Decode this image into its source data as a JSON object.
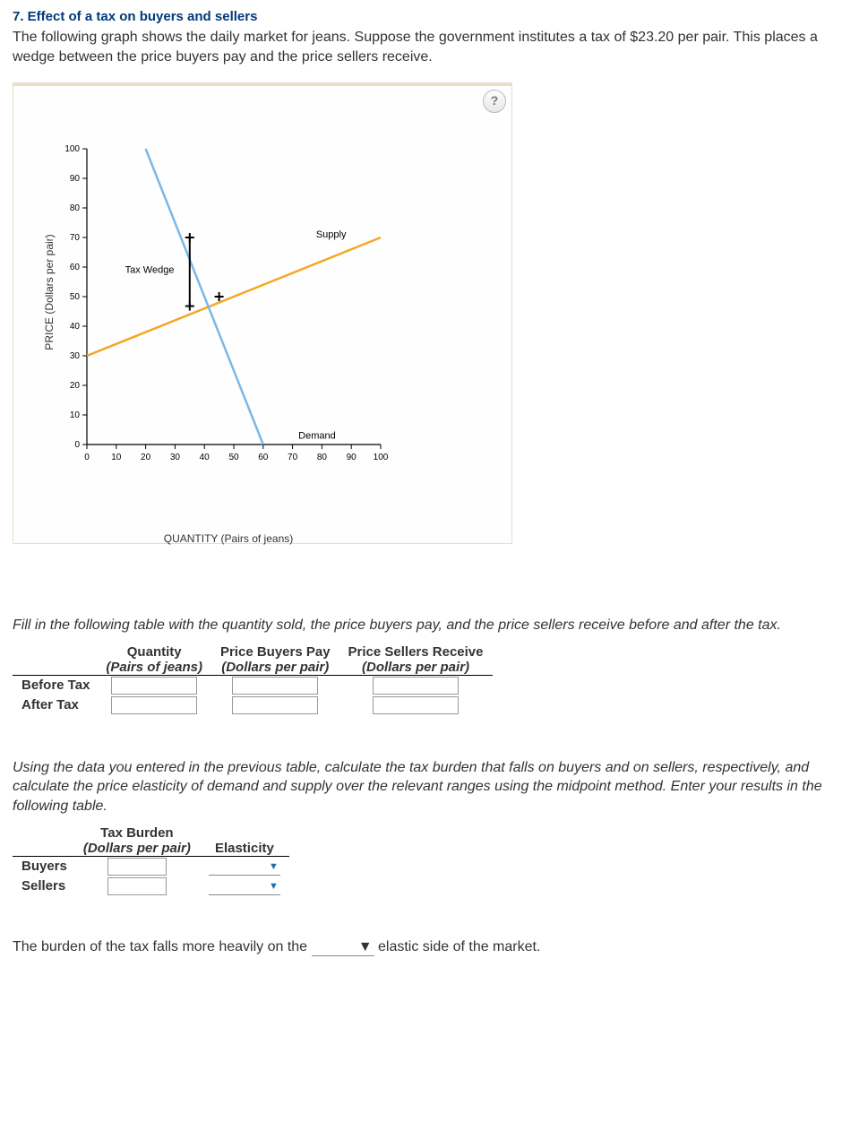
{
  "title": "7. Effect of a tax on buyers and sellers",
  "intro": "The following graph shows the daily market for jeans. Suppose the government institutes a tax of $23.20 per pair. This places a wedge between the price buyers pay and the price sellers receive.",
  "help_label": "?",
  "chart_data": {
    "type": "line",
    "xlabel": "QUANTITY (Pairs of jeans)",
    "ylabel": "PRICE (Dollars per pair)",
    "xlim": [
      0,
      100
    ],
    "ylim": [
      0,
      100
    ],
    "xticks": [
      0,
      10,
      20,
      30,
      40,
      50,
      60,
      70,
      80,
      90,
      100
    ],
    "yticks": [
      0,
      10,
      20,
      30,
      40,
      50,
      60,
      70,
      80,
      90,
      100
    ],
    "series": [
      {
        "name": "Supply",
        "color": "#f5a623",
        "x": [
          0,
          100
        ],
        "y": [
          30,
          70
        ]
      },
      {
        "name": "Demand",
        "color": "#7ab8e6",
        "x": [
          20,
          60
        ],
        "y": [
          100,
          0
        ]
      }
    ],
    "tax_wedge_label": "Tax Wedge",
    "wedge": {
      "x": 35,
      "y_top": 70,
      "y_bottom": 46.8
    },
    "equilibrium_marker": {
      "x": 45,
      "y": 50
    }
  },
  "table1": {
    "instr": "Fill in the following table with the quantity sold, the price buyers pay, and the price sellers receive before and after the tax.",
    "cols": [
      {
        "top": "Quantity",
        "sub": "(Pairs of jeans)"
      },
      {
        "top": "Price Buyers Pay",
        "sub": "(Dollars per pair)"
      },
      {
        "top": "Price Sellers Receive",
        "sub": "(Dollars per pair)"
      }
    ],
    "rows": [
      "Before Tax",
      "After Tax"
    ]
  },
  "table2": {
    "instr": "Using the data you entered in the previous table, calculate the tax burden that falls on buyers and on sellers, respectively, and calculate the price elasticity of demand and supply over the relevant ranges using the midpoint method. Enter your results in the following table.",
    "cols": [
      {
        "top": "Tax Burden",
        "sub": "(Dollars per pair)"
      },
      {
        "top": "Elasticity",
        "sub": ""
      }
    ],
    "rows": [
      "Buyers",
      "Sellers"
    ]
  },
  "final": {
    "pre": "The burden of the tax falls more heavily on the ",
    "post": " elastic side of the market."
  }
}
